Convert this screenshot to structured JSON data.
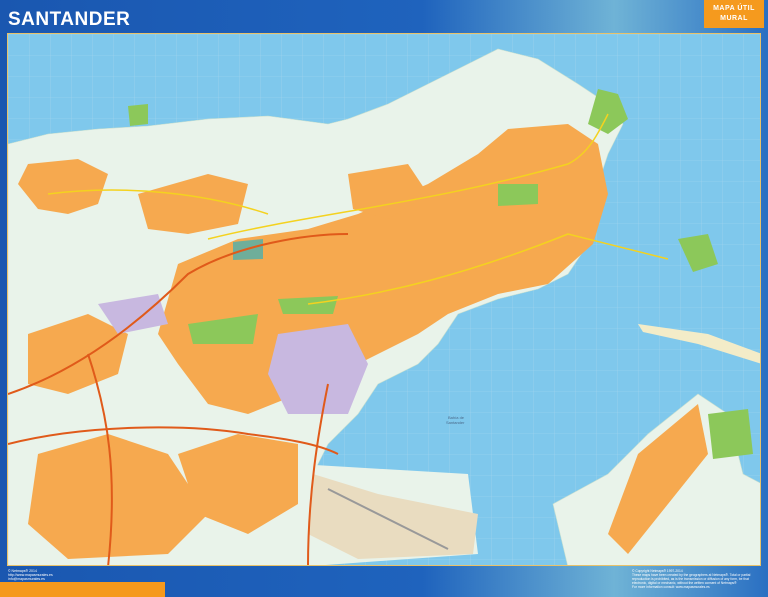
{
  "header": {
    "title": "SANTANDER",
    "badge_line1": "MAPA ÚTIL",
    "badge_line2": "MURAL"
  },
  "map": {
    "water_label_line1": "Bahía de",
    "water_label_line2": "Santander",
    "colors": {
      "sea": "#7fc8ec",
      "land": "#e9f3ea",
      "urban": "#f6a94f",
      "park": "#8cc85a",
      "industrial": "#c8b8e0",
      "highway": "#e05a1a",
      "airport": "#e9dcc0"
    }
  },
  "footer": {
    "left": [
      "© Netmaps® 2014",
      "http://www.mapasmurales.es",
      "info@mapasmurales.es"
    ],
    "right": [
      "© Copyright Netmaps® 1997-2014",
      "These maps have been created by the geographers at Netmaps®. Total or partial",
      "reproduction is prohibited, as is the transmission or diffusion of any form, be that",
      "electronic, digital or mechanic, without the written consent of Netmaps®",
      "For more information consult: www.mapasmurales.es"
    ]
  }
}
